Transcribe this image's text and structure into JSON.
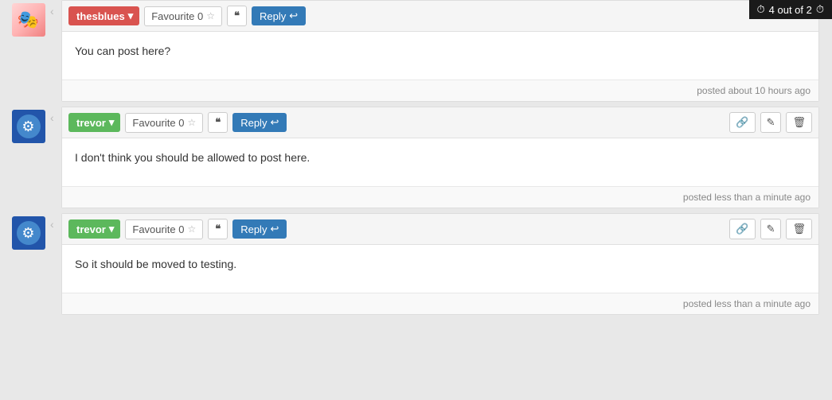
{
  "badge": {
    "text": "4 out of 2",
    "icon": "clock"
  },
  "posts": [
    {
      "id": "post-1",
      "author": "thesblues",
      "author_color": "red",
      "avatar_type": "anime",
      "toolbar_partial": true,
      "favourite_label": "Favourite 0",
      "favourite_count": "0",
      "quote_label": "“”",
      "reply_label": "Reply",
      "content": "You can post here?",
      "posted_at": "posted about 10 hours ago",
      "show_action_icons": false
    },
    {
      "id": "post-2",
      "author": "trevor",
      "author_color": "green",
      "avatar_type": "gear",
      "toolbar_partial": false,
      "favourite_label": "Favourite 0",
      "favourite_count": "0",
      "quote_label": "“”",
      "reply_label": "Reply",
      "content": "I don't think you should be allowed to post here.",
      "posted_at": "posted less than a minute ago",
      "show_action_icons": true,
      "action_icons": [
        "link",
        "edit",
        "delete"
      ]
    },
    {
      "id": "post-3",
      "author": "trevor",
      "author_color": "green",
      "avatar_type": "gear",
      "toolbar_partial": false,
      "favourite_label": "Favourite 0",
      "favourite_count": "0",
      "quote_label": "“”",
      "reply_label": "Reply",
      "content": "So it should be moved to testing.",
      "posted_at": "posted less than a minute ago",
      "show_action_icons": true,
      "action_icons": [
        "link",
        "edit",
        "delete"
      ]
    }
  ],
  "nav_arrow": "‹",
  "dropdown_symbol": "▾",
  "star_symbol": "☆",
  "reply_arrow": "↩",
  "link_icon": "🔗",
  "edit_icon": "✎",
  "delete_icon": "🗑",
  "clock_icon": "⏱"
}
